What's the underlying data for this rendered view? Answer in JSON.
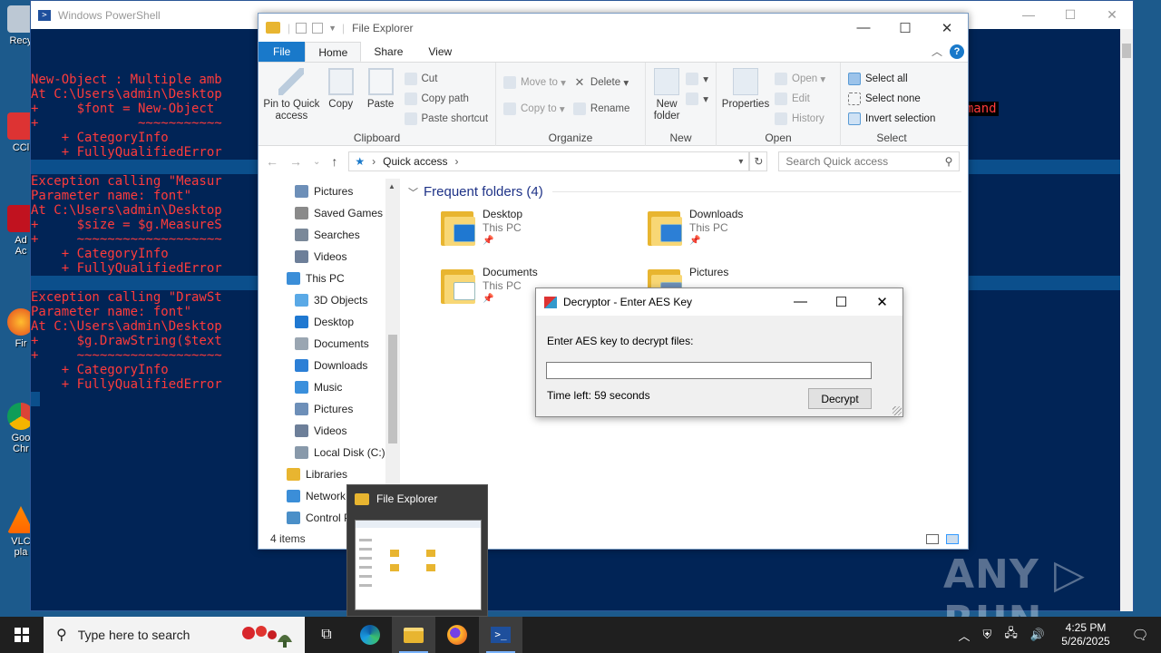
{
  "desktop": {
    "icons": [
      {
        "label": "Recy"
      },
      {
        "label": "CCl"
      },
      {
        "label": "Ad"
      },
      {
        "label": "Ac"
      },
      {
        "label": "Fir"
      },
      {
        "label": "Goo"
      },
      {
        "label": "Chr"
      },
      {
        "label": "VLC"
      },
      {
        "label": "pla"
      }
    ],
    "watermark": "ANY ▷ RUN"
  },
  "powershell": {
    "title": "Windows PowerShell",
    "lines": [
      "New-Object : Multiple amb",
      "At C:\\Users\\admin\\Desktop",
      "+     $font = New-Object",
      "+             ~~~~~~~~~~~",
      "    + CategoryInfo",
      "    + FullyQualifiedError",
      "",
      "Exception calling \"Measur",
      "Parameter name: font\"",
      "At C:\\Users\\admin\\Desktop",
      "+     $size = $g.MeasureS",
      "+     ~~~~~~~~~~~~~~~~~~~",
      "    + CategoryInfo",
      "    + FullyQualifiedError",
      "",
      "Exception calling \"DrawSt",
      "Parameter name: font\"",
      "At C:\\Users\\admin\\Desktop",
      "+     $g.DrawString($text",
      "+     ~~~~~~~~~~~~~~~~~~~",
      "    + CategoryInfo",
      "    + FullyQualifiedError"
    ],
    "tail_text": "ommand"
  },
  "explorer": {
    "title": "File Explorer",
    "tabs": {
      "file": "File",
      "home": "Home",
      "share": "Share",
      "view": "View"
    },
    "help": "?",
    "ribbon": {
      "clipboard": {
        "label": "Clipboard",
        "pin": "Pin to Quick access",
        "copy": "Copy",
        "paste": "Paste",
        "cut": "Cut",
        "copy_path": "Copy path",
        "paste_shortcut": "Paste shortcut"
      },
      "organize": {
        "label": "Organize",
        "move_to": "Move to",
        "copy_to": "Copy to",
        "delete": "Delete",
        "rename": "Rename"
      },
      "new": {
        "label": "New",
        "new_folder": "New folder"
      },
      "open": {
        "label": "Open",
        "properties": "Properties",
        "open": "Open",
        "edit": "Edit",
        "history": "History"
      },
      "select": {
        "label": "Select",
        "select_all": "Select all",
        "select_none": "Select none",
        "invert": "Invert selection"
      }
    },
    "address": {
      "path": "Quick access"
    },
    "search_placeholder": "Search Quick access",
    "nav": [
      {
        "label": "Pictures",
        "color": "#6d8fb8",
        "indent": 1
      },
      {
        "label": "Saved Games",
        "color": "#8a8a8a",
        "indent": 1
      },
      {
        "label": "Searches",
        "color": "#7a8899",
        "indent": 1
      },
      {
        "label": "Videos",
        "color": "#6d7f99",
        "indent": 1
      },
      {
        "label": "This PC",
        "color": "#3b8ed8",
        "indent": 0
      },
      {
        "label": "3D Objects",
        "color": "#5aa9e6",
        "indent": 1
      },
      {
        "label": "Desktop",
        "color": "#1f78d1",
        "indent": 1
      },
      {
        "label": "Documents",
        "color": "#9aa6b2",
        "indent": 1
      },
      {
        "label": "Downloads",
        "color": "#2c7fd6",
        "indent": 1
      },
      {
        "label": "Music",
        "color": "#3a8fdc",
        "indent": 1
      },
      {
        "label": "Pictures",
        "color": "#6d8fb8",
        "indent": 1
      },
      {
        "label": "Videos",
        "color": "#6d7f99",
        "indent": 1
      },
      {
        "label": "Local Disk (C:)",
        "color": "#8899aa",
        "indent": 1
      },
      {
        "label": "Libraries",
        "color": "#e8b530",
        "indent": 0
      },
      {
        "label": "Network",
        "color": "#3b8ed8",
        "indent": 0
      },
      {
        "label": "Control Panel",
        "color": "#4a8fc8",
        "indent": 0
      }
    ],
    "section_title": "Frequent folders (4)",
    "folders": [
      {
        "name": "Desktop",
        "location": "This PC",
        "badge": "#1f78d1"
      },
      {
        "name": "Downloads",
        "location": "This PC",
        "badge": "#2c7fd6"
      },
      {
        "name": "Documents",
        "location": "This PC",
        "badge": "#ffffff"
      },
      {
        "name": "Pictures",
        "location": "",
        "badge": "#6d8fb8"
      }
    ],
    "status": "4 items"
  },
  "decryptor": {
    "title": "Decryptor - Enter AES Key",
    "prompt": "Enter AES key to decrypt files:",
    "key_value": "",
    "timer": "Time left: 59 seconds",
    "button": "Decrypt"
  },
  "preview": {
    "title": "File Explorer"
  },
  "taskbar": {
    "search_placeholder": "Type here to search",
    "time": "4:25 PM",
    "date": "5/26/2025"
  },
  "colors": {
    "accent": "#1979ca",
    "ps_bg": "#012456",
    "ps_error": "#ff3b3b"
  }
}
